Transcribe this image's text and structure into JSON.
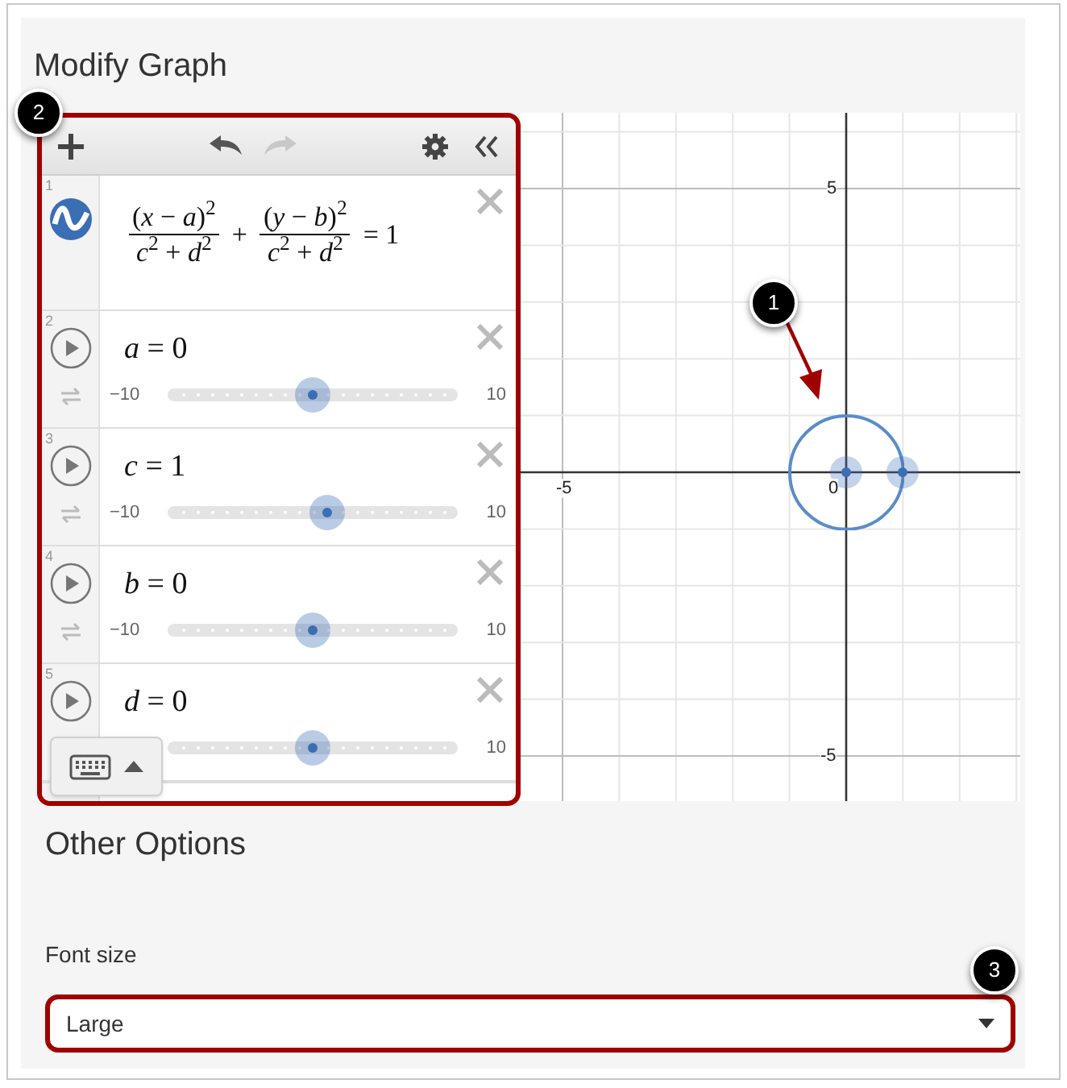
{
  "title": "Modify Graph",
  "toolbar": {
    "undo_enabled": true,
    "redo_enabled": false
  },
  "expressions": [
    {
      "kind": "formula",
      "number": "1",
      "terms": [
        {
          "kind": "fraction",
          "numerator": "(*x* − *a*)$^{2}$",
          "denominator": "*c*$^{2}$ + *d*$^{2}$"
        },
        {
          "kind": "operator",
          "text": "+"
        },
        {
          "kind": "fraction",
          "numerator": "(*y* − *b*)$^{2}$",
          "denominator": "*c*$^{2}$ + *d*$^{2}$"
        },
        {
          "kind": "operator",
          "text": "= 1"
        }
      ]
    },
    {
      "kind": "slider",
      "number": "2",
      "label": "*a* = 0",
      "min": "−10",
      "max": "10",
      "level": 0.5
    },
    {
      "kind": "slider",
      "number": "3",
      "label": "*c* = 1",
      "min": "−10",
      "max": "10",
      "level": 0.55
    },
    {
      "kind": "slider",
      "number": "4",
      "label": "*b* = 0",
      "min": "−10",
      "max": "10",
      "level": 0.5
    },
    {
      "kind": "slider",
      "number": "5",
      "label": "*d* = 0",
      "max": "10",
      "level": 0.5
    }
  ],
  "graph": {
    "origin_label": "0",
    "x_labels": [
      "-5"
    ],
    "y_labels": [
      "5",
      "-5"
    ]
  },
  "other_options": {
    "heading": "Other Options",
    "font_size": {
      "label": "Font size",
      "value": "Large"
    }
  },
  "callouts": [
    "1",
    "2",
    "3"
  ]
}
